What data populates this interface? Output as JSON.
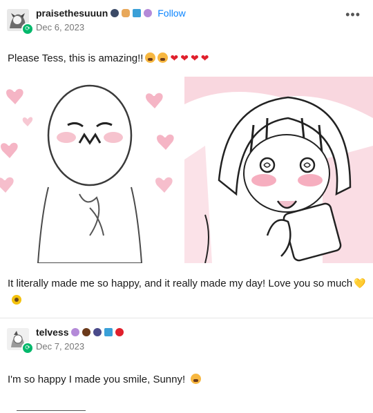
{
  "post1": {
    "username": "praisethesuuun",
    "follow_label": "Follow",
    "date": "Dec 6, 2023",
    "more_label": "•••",
    "body_text": "Please Tess, this is amazing!!",
    "caption_text": "It literally made me so happy, and it really made my day! Love you so much"
  },
  "post2": {
    "username": "telvess",
    "date": "Dec 7, 2023",
    "body_text": "I'm so happy I made you smile, Sunny!"
  },
  "colors": {
    "follow_blue": "#0a84ff",
    "badge_green": "#00b86b",
    "heart_red": "#e0202c",
    "pink": "#f3a7b8"
  },
  "icons": [
    "cry-emoji-icon",
    "red-heart-icon",
    "yellow-heart-icon",
    "sunflower-icon",
    "more-options-icon",
    "reblog-badge-icon"
  ]
}
